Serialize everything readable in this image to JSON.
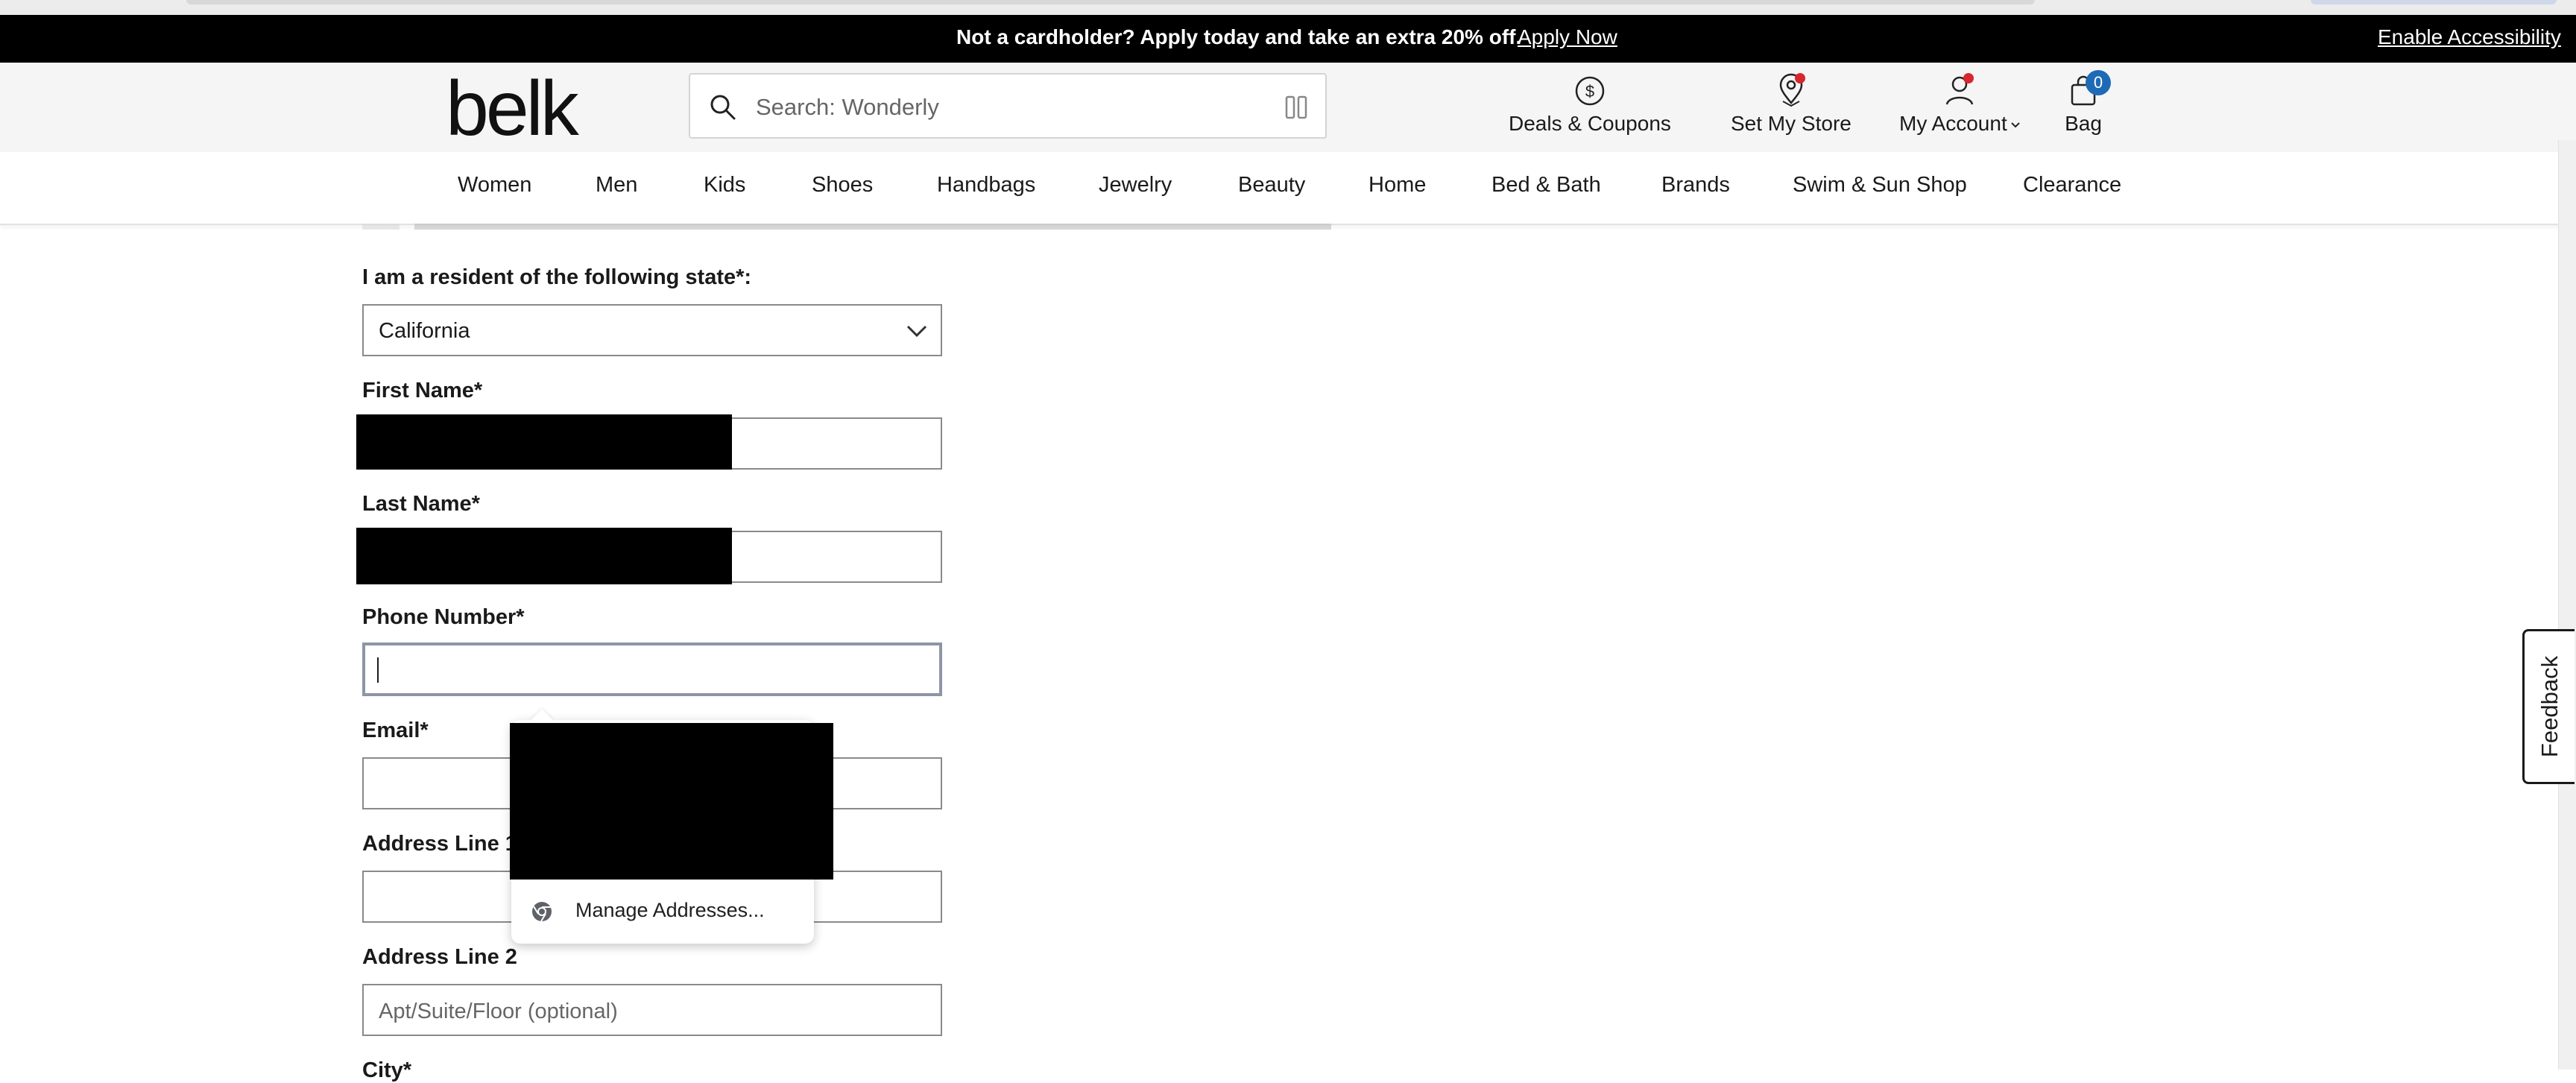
{
  "promo": {
    "text": "Not a cardholder? Apply today and take an extra 20% off.",
    "apply_link": "Apply Now",
    "accessibility_link": "Enable Accessibility"
  },
  "header": {
    "logo": "belk",
    "search_placeholder": "Search: Wonderly",
    "deals_label": "Deals & Coupons",
    "store_label": "Set My Store",
    "account_label": "My Account",
    "bag_label": "Bag",
    "bag_count": "0"
  },
  "nav": {
    "items": [
      "Women",
      "Men",
      "Kids",
      "Shoes",
      "Handbags",
      "Jewelry",
      "Beauty",
      "Home",
      "Bed & Bath",
      "Brands",
      "Swim & Sun Shop",
      "Clearance"
    ]
  },
  "form": {
    "state_label": "I am a resident of the following state*:",
    "state_value": "California",
    "first_name_label": "First Name*",
    "last_name_label": "Last Name*",
    "phone_label": "Phone Number*",
    "email_label": "Email*",
    "address1_label": "Address Line 1*",
    "address2_label": "Address Line 2",
    "address2_placeholder": "Apt/Suite/Floor (optional)",
    "city_label": "City*"
  },
  "autofill": {
    "manage_label": "Manage Addresses..."
  },
  "feedback": {
    "label": "Feedback"
  },
  "colors": {
    "promo_bg": "#000000",
    "header_bg": "#f5f5f5",
    "badge": "#1e6ab7",
    "notification_dot": "#d8262d"
  }
}
